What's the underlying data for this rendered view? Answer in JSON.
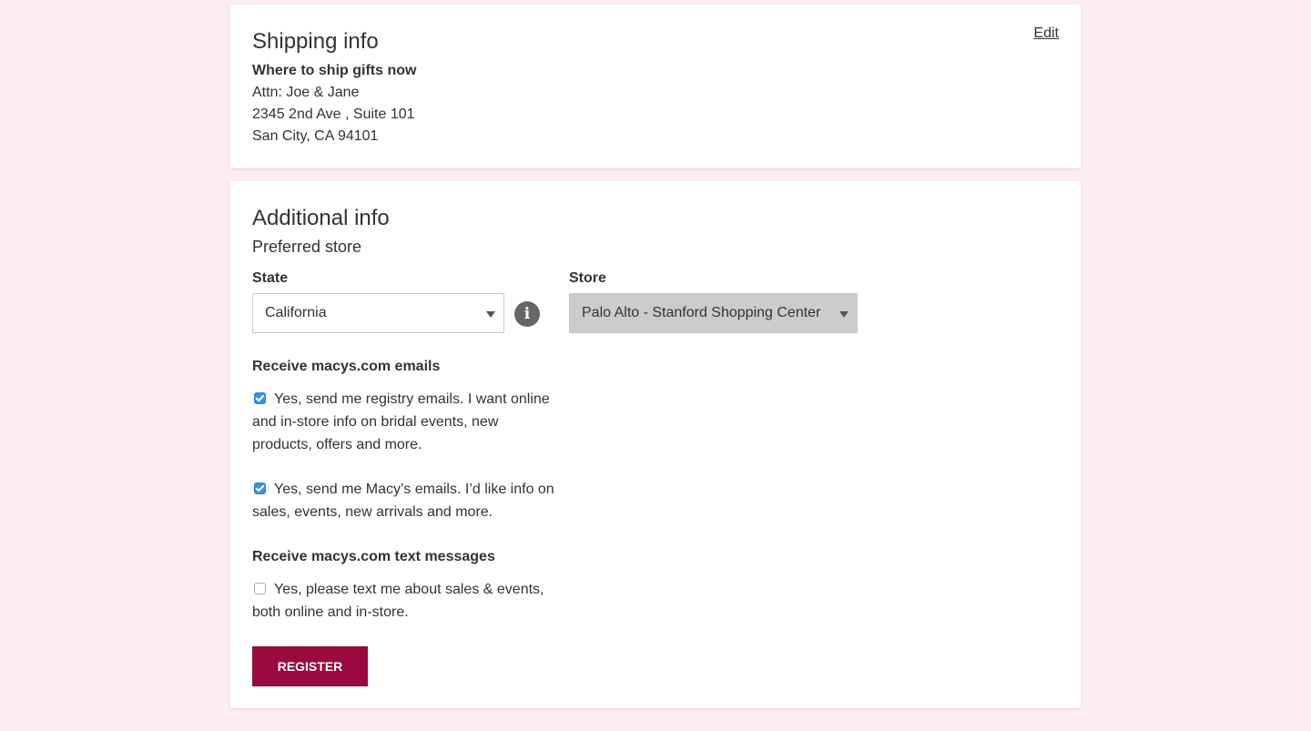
{
  "shipping": {
    "title": "Shipping info",
    "edit_label": "Edit",
    "subheading": "Where to ship gifts now",
    "attn": "Attn: Joe & Jane",
    "address_line": "2345 2nd Ave , Suite 101",
    "city_line": "San City, CA 94101"
  },
  "additional": {
    "title": "Additional info",
    "preferred_store": "Preferred store",
    "state_label": "State",
    "state_value": "California",
    "store_label": "Store",
    "store_value": "Palo Alto - Stanford Shopping Center",
    "info_icon": "info-icon",
    "emails_heading": "Receive macys.com emails",
    "registry_emails_text": "Yes, send me registry emails. I want online and in-store info on bridal events, new products, offers and more.",
    "registry_emails_checked": true,
    "macys_emails_text": "Yes, send me Macy’s emails. I’d like info on sales, events, new arrivals and more.",
    "macys_emails_checked": true,
    "texts_heading": "Receive macys.com text messages",
    "texts_text": "Yes, please text me about sales & events, both online and in-store.",
    "texts_checked": false,
    "register_label": "REGISTER"
  },
  "colors": {
    "page_background": "#fdebef",
    "register_button": "#990a3f",
    "checkbox_checked": "#3b8ee8",
    "store_select_disabled": "#cccccc"
  }
}
